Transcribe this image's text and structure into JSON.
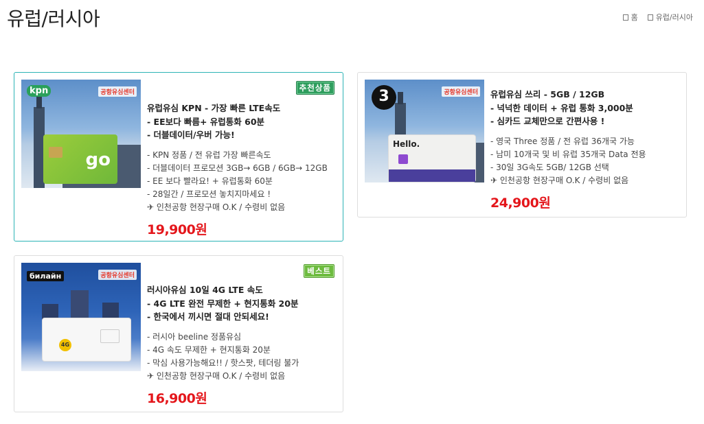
{
  "page": {
    "title": "유럽/러시아"
  },
  "breadcrumb": {
    "home_label": "홈",
    "current_label": "유럽/러시아"
  },
  "products": [
    {
      "name": "kpn",
      "badge": "추천상품",
      "brand_logo": "kpn",
      "partner_logo": "공항유심센터",
      "headline": [
        "유럽유심 KPN - 가장 빠른 LTE속도",
        "- EE보다 빠름+ 유럽통화 60분",
        "- 더블데이터/우버 가능!"
      ],
      "features": [
        "- KPN 정품 / 전 유럽 가장 빠른속도",
        "- 더블데이터 프로모션 3GB→ 6GB / 6GB→ 12GB",
        "- EE 보다 빨라요! + 유럽통화 60분",
        "- 28일간 / 프로모션 놓치지마세요 !",
        "✈ 인천공항 현장구매 O.K / 수령비 없음"
      ],
      "price": "19,900원"
    },
    {
      "name": "three",
      "badge": "",
      "brand_logo": "3",
      "partner_logo": "공항유심센터",
      "headline": [
        "유럽유심 쓰리 - 5GB / 12GB",
        "- 넉넉한 데이터 + 유럽 통화 3,000분",
        "- 심카드 교체만으로 간편사용 !"
      ],
      "features": [
        "- 영국 Three 정품 / 전 유럽 36개국 가능",
        "- 남미 10개국 및 비 유럽 35개국 Data 전용",
        "- 30일 3G속도 5GB/ 12GB 선택",
        "✈ 인천공항 현장구매 O.K / 수령비 없음"
      ],
      "price": "24,900원"
    },
    {
      "name": "beeline",
      "badge": "베스트",
      "brand_logo": "билайн",
      "partner_logo": "공항유심센터",
      "headline": [
        "러시아유심 10일 4G LTE 속도",
        "- 4G LTE 완전 무제한 + 현지통화 20분",
        "- 한국에서 끼시면 절대 안되세요!"
      ],
      "features": [
        "- 러시아 beeline 정품유심",
        "- 4G 속도 무제한 + 현지통화 20분",
        "- 막심 사용가능해요!! / 핫스팟, 테더링 불가",
        "✈ 인천공항 현장구매 O.K / 수령비 없음"
      ],
      "price": "16,900원"
    }
  ],
  "icons": {
    "home": "home-icon",
    "breadcrumb_sep": "folder-icon"
  },
  "colors": {
    "price": "#e4161b",
    "highlight_border": "#2bb3b5",
    "badge_recommend": "#2f9e5e",
    "badge_best": "#6dbb3f"
  }
}
